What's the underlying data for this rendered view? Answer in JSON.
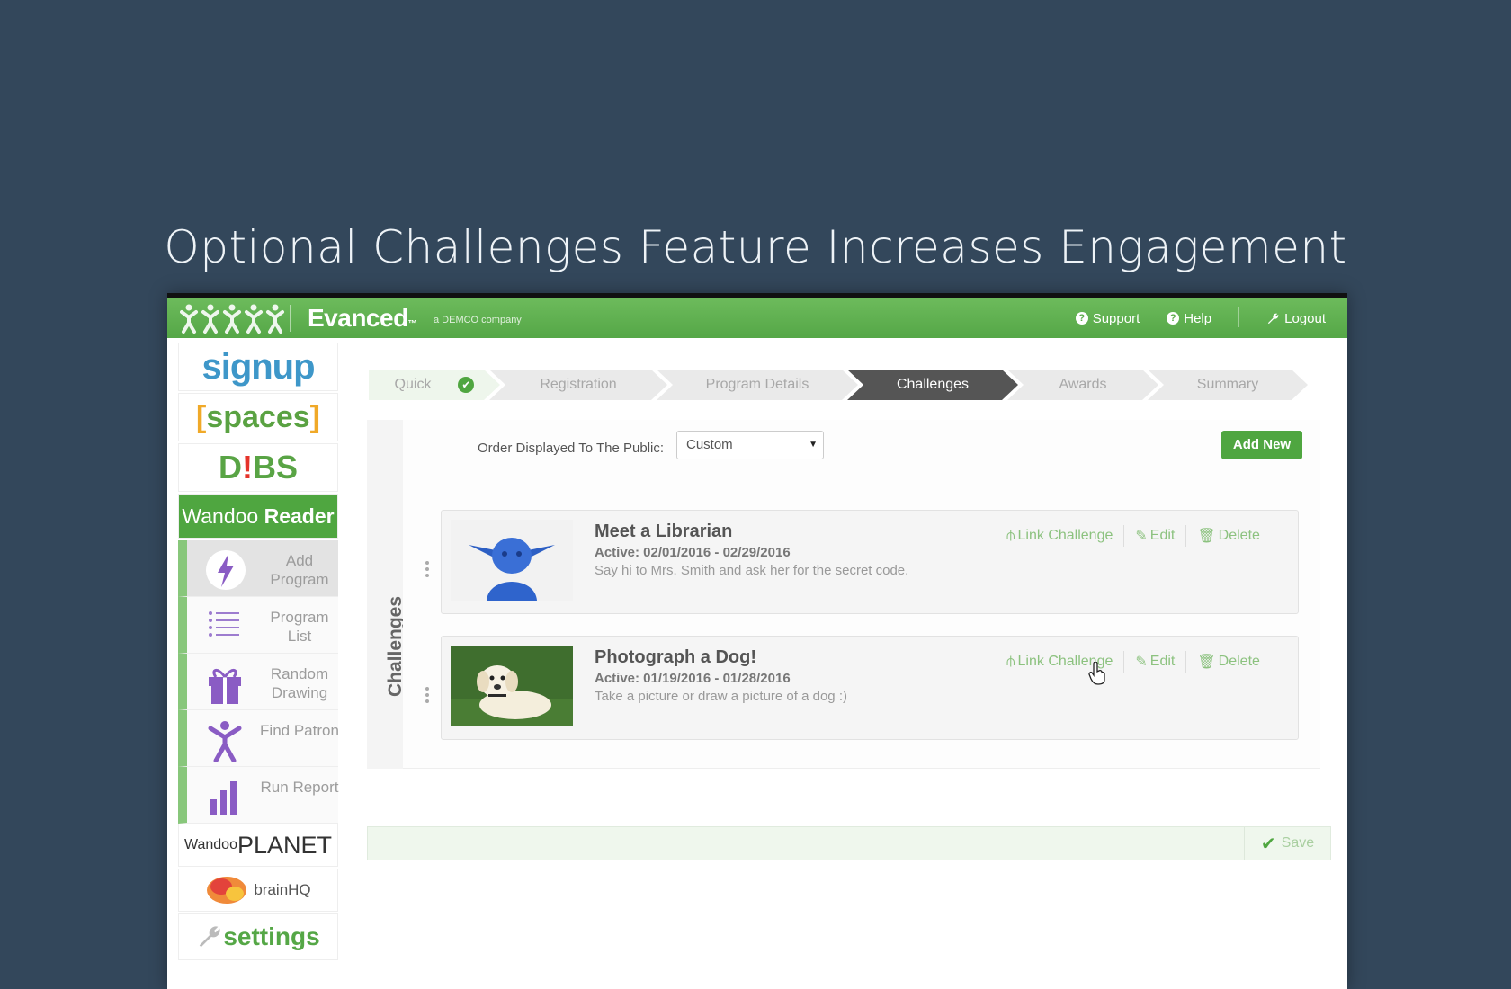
{
  "headline": "Optional Challenges Feature Increases Engagement",
  "topbar": {
    "brand": "Evanced",
    "brand_tm": "™",
    "brand_sub": "a DEMCO company",
    "links": {
      "support": "Support",
      "help": "Help",
      "logout": "Logout"
    }
  },
  "sidebar": {
    "products": {
      "signup": "signup",
      "spaces_open": "[",
      "spaces_word": "spaces",
      "spaces_close": "]",
      "dibs_d": "D",
      "dibs_bang": "!",
      "dibs_bs": "BS",
      "wandoo_a": "Wandoo",
      "wandoo_b": "Reader",
      "planet_a": "Wandoo",
      "planet_b": "PLANET",
      "brain": "brainHQ",
      "settings": "settings"
    },
    "menu": [
      {
        "label": "Add Program"
      },
      {
        "label": "Program List"
      },
      {
        "label": "Random Drawing"
      },
      {
        "label": "Find Patron"
      },
      {
        "label": "Run Report"
      }
    ]
  },
  "wizard": {
    "steps": [
      "Quick",
      "Registration",
      "Program Details",
      "Challenges",
      "Awards",
      "Summary"
    ]
  },
  "panel": {
    "vertical_tab": "Challenges",
    "order_label": "Order Displayed To The Public:",
    "order_value": "Custom",
    "add_new": "Add New"
  },
  "challenges": [
    {
      "title": "Meet a Librarian",
      "dates": "Active: 02/01/2016 - 02/29/2016",
      "description": "Say hi to Mrs. Smith and ask her for the secret code."
    },
    {
      "title": "Photograph a Dog!",
      "dates": "Active: 01/19/2016 - 01/28/2016",
      "description": "Take a picture or draw a picture of a dog :)"
    }
  ],
  "actions": {
    "link": "Link Challenge",
    "edit": "Edit",
    "delete": "Delete"
  },
  "save": "Save",
  "colors": {
    "background": "#33475b",
    "brand_green": "#55a747",
    "current_step": "#555555"
  }
}
